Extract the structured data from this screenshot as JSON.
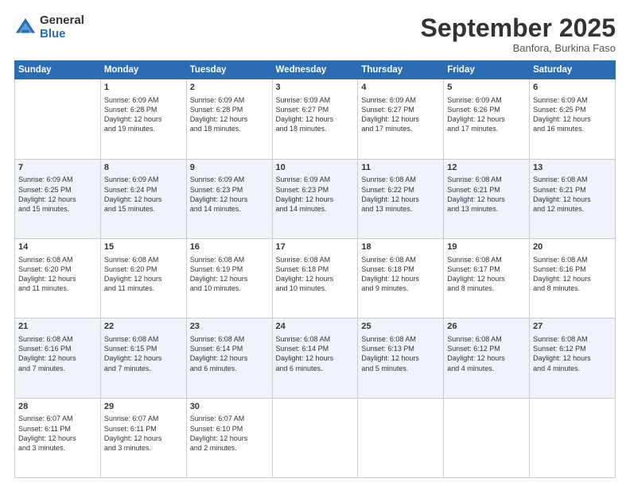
{
  "logo": {
    "general": "General",
    "blue": "Blue"
  },
  "header": {
    "month": "September 2025",
    "location": "Banfora, Burkina Faso"
  },
  "weekdays": [
    "Sunday",
    "Monday",
    "Tuesday",
    "Wednesday",
    "Thursday",
    "Friday",
    "Saturday"
  ],
  "weeks": [
    [
      {
        "day": "",
        "info": ""
      },
      {
        "day": "1",
        "info": "Sunrise: 6:09 AM\nSunset: 6:28 PM\nDaylight: 12 hours\nand 19 minutes."
      },
      {
        "day": "2",
        "info": "Sunrise: 6:09 AM\nSunset: 6:28 PM\nDaylight: 12 hours\nand 18 minutes."
      },
      {
        "day": "3",
        "info": "Sunrise: 6:09 AM\nSunset: 6:27 PM\nDaylight: 12 hours\nand 18 minutes."
      },
      {
        "day": "4",
        "info": "Sunrise: 6:09 AM\nSunset: 6:27 PM\nDaylight: 12 hours\nand 17 minutes."
      },
      {
        "day": "5",
        "info": "Sunrise: 6:09 AM\nSunset: 6:26 PM\nDaylight: 12 hours\nand 17 minutes."
      },
      {
        "day": "6",
        "info": "Sunrise: 6:09 AM\nSunset: 6:25 PM\nDaylight: 12 hours\nand 16 minutes."
      }
    ],
    [
      {
        "day": "7",
        "info": "Sunrise: 6:09 AM\nSunset: 6:25 PM\nDaylight: 12 hours\nand 15 minutes."
      },
      {
        "day": "8",
        "info": "Sunrise: 6:09 AM\nSunset: 6:24 PM\nDaylight: 12 hours\nand 15 minutes."
      },
      {
        "day": "9",
        "info": "Sunrise: 6:09 AM\nSunset: 6:23 PM\nDaylight: 12 hours\nand 14 minutes."
      },
      {
        "day": "10",
        "info": "Sunrise: 6:09 AM\nSunset: 6:23 PM\nDaylight: 12 hours\nand 14 minutes."
      },
      {
        "day": "11",
        "info": "Sunrise: 6:08 AM\nSunset: 6:22 PM\nDaylight: 12 hours\nand 13 minutes."
      },
      {
        "day": "12",
        "info": "Sunrise: 6:08 AM\nSunset: 6:21 PM\nDaylight: 12 hours\nand 13 minutes."
      },
      {
        "day": "13",
        "info": "Sunrise: 6:08 AM\nSunset: 6:21 PM\nDaylight: 12 hours\nand 12 minutes."
      }
    ],
    [
      {
        "day": "14",
        "info": "Sunrise: 6:08 AM\nSunset: 6:20 PM\nDaylight: 12 hours\nand 11 minutes."
      },
      {
        "day": "15",
        "info": "Sunrise: 6:08 AM\nSunset: 6:20 PM\nDaylight: 12 hours\nand 11 minutes."
      },
      {
        "day": "16",
        "info": "Sunrise: 6:08 AM\nSunset: 6:19 PM\nDaylight: 12 hours\nand 10 minutes."
      },
      {
        "day": "17",
        "info": "Sunrise: 6:08 AM\nSunset: 6:18 PM\nDaylight: 12 hours\nand 10 minutes."
      },
      {
        "day": "18",
        "info": "Sunrise: 6:08 AM\nSunset: 6:18 PM\nDaylight: 12 hours\nand 9 minutes."
      },
      {
        "day": "19",
        "info": "Sunrise: 6:08 AM\nSunset: 6:17 PM\nDaylight: 12 hours\nand 8 minutes."
      },
      {
        "day": "20",
        "info": "Sunrise: 6:08 AM\nSunset: 6:16 PM\nDaylight: 12 hours\nand 8 minutes."
      }
    ],
    [
      {
        "day": "21",
        "info": "Sunrise: 6:08 AM\nSunset: 6:16 PM\nDaylight: 12 hours\nand 7 minutes."
      },
      {
        "day": "22",
        "info": "Sunrise: 6:08 AM\nSunset: 6:15 PM\nDaylight: 12 hours\nand 7 minutes."
      },
      {
        "day": "23",
        "info": "Sunrise: 6:08 AM\nSunset: 6:14 PM\nDaylight: 12 hours\nand 6 minutes."
      },
      {
        "day": "24",
        "info": "Sunrise: 6:08 AM\nSunset: 6:14 PM\nDaylight: 12 hours\nand 6 minutes."
      },
      {
        "day": "25",
        "info": "Sunrise: 6:08 AM\nSunset: 6:13 PM\nDaylight: 12 hours\nand 5 minutes."
      },
      {
        "day": "26",
        "info": "Sunrise: 6:08 AM\nSunset: 6:12 PM\nDaylight: 12 hours\nand 4 minutes."
      },
      {
        "day": "27",
        "info": "Sunrise: 6:08 AM\nSunset: 6:12 PM\nDaylight: 12 hours\nand 4 minutes."
      }
    ],
    [
      {
        "day": "28",
        "info": "Sunrise: 6:07 AM\nSunset: 6:11 PM\nDaylight: 12 hours\nand 3 minutes."
      },
      {
        "day": "29",
        "info": "Sunrise: 6:07 AM\nSunset: 6:11 PM\nDaylight: 12 hours\nand 3 minutes."
      },
      {
        "day": "30",
        "info": "Sunrise: 6:07 AM\nSunset: 6:10 PM\nDaylight: 12 hours\nand 2 minutes."
      },
      {
        "day": "",
        "info": ""
      },
      {
        "day": "",
        "info": ""
      },
      {
        "day": "",
        "info": ""
      },
      {
        "day": "",
        "info": ""
      }
    ]
  ]
}
